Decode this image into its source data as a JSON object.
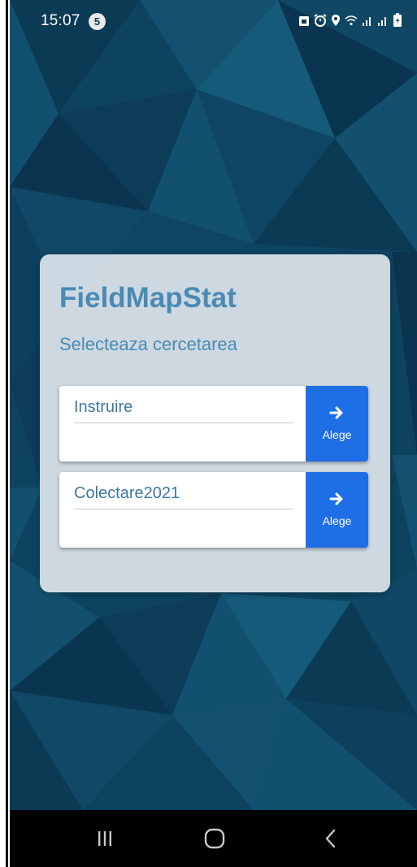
{
  "status_bar": {
    "time": "15:07",
    "notification_count": "5",
    "icons": [
      "lock-icon",
      "alarm-icon",
      "location-icon",
      "wifi-icon",
      "signal-icon",
      "signal-icon",
      "battery-icon"
    ]
  },
  "card": {
    "title": "FieldMapStat",
    "subtitle": "Selecteaza cercetarea"
  },
  "surveys": [
    {
      "name": "Instruire",
      "button_label": "Alege",
      "button_icon": "arrow-right-icon"
    },
    {
      "name": "Colectare2021",
      "button_label": "Alege",
      "button_icon": "arrow-right-icon"
    }
  ],
  "nav_bar": {
    "buttons": [
      "recent-apps-icon",
      "home-icon",
      "back-icon"
    ]
  },
  "colors": {
    "background": "#0d3d58",
    "accent": "#4a8ab5",
    "button": "#1e6fe6"
  }
}
